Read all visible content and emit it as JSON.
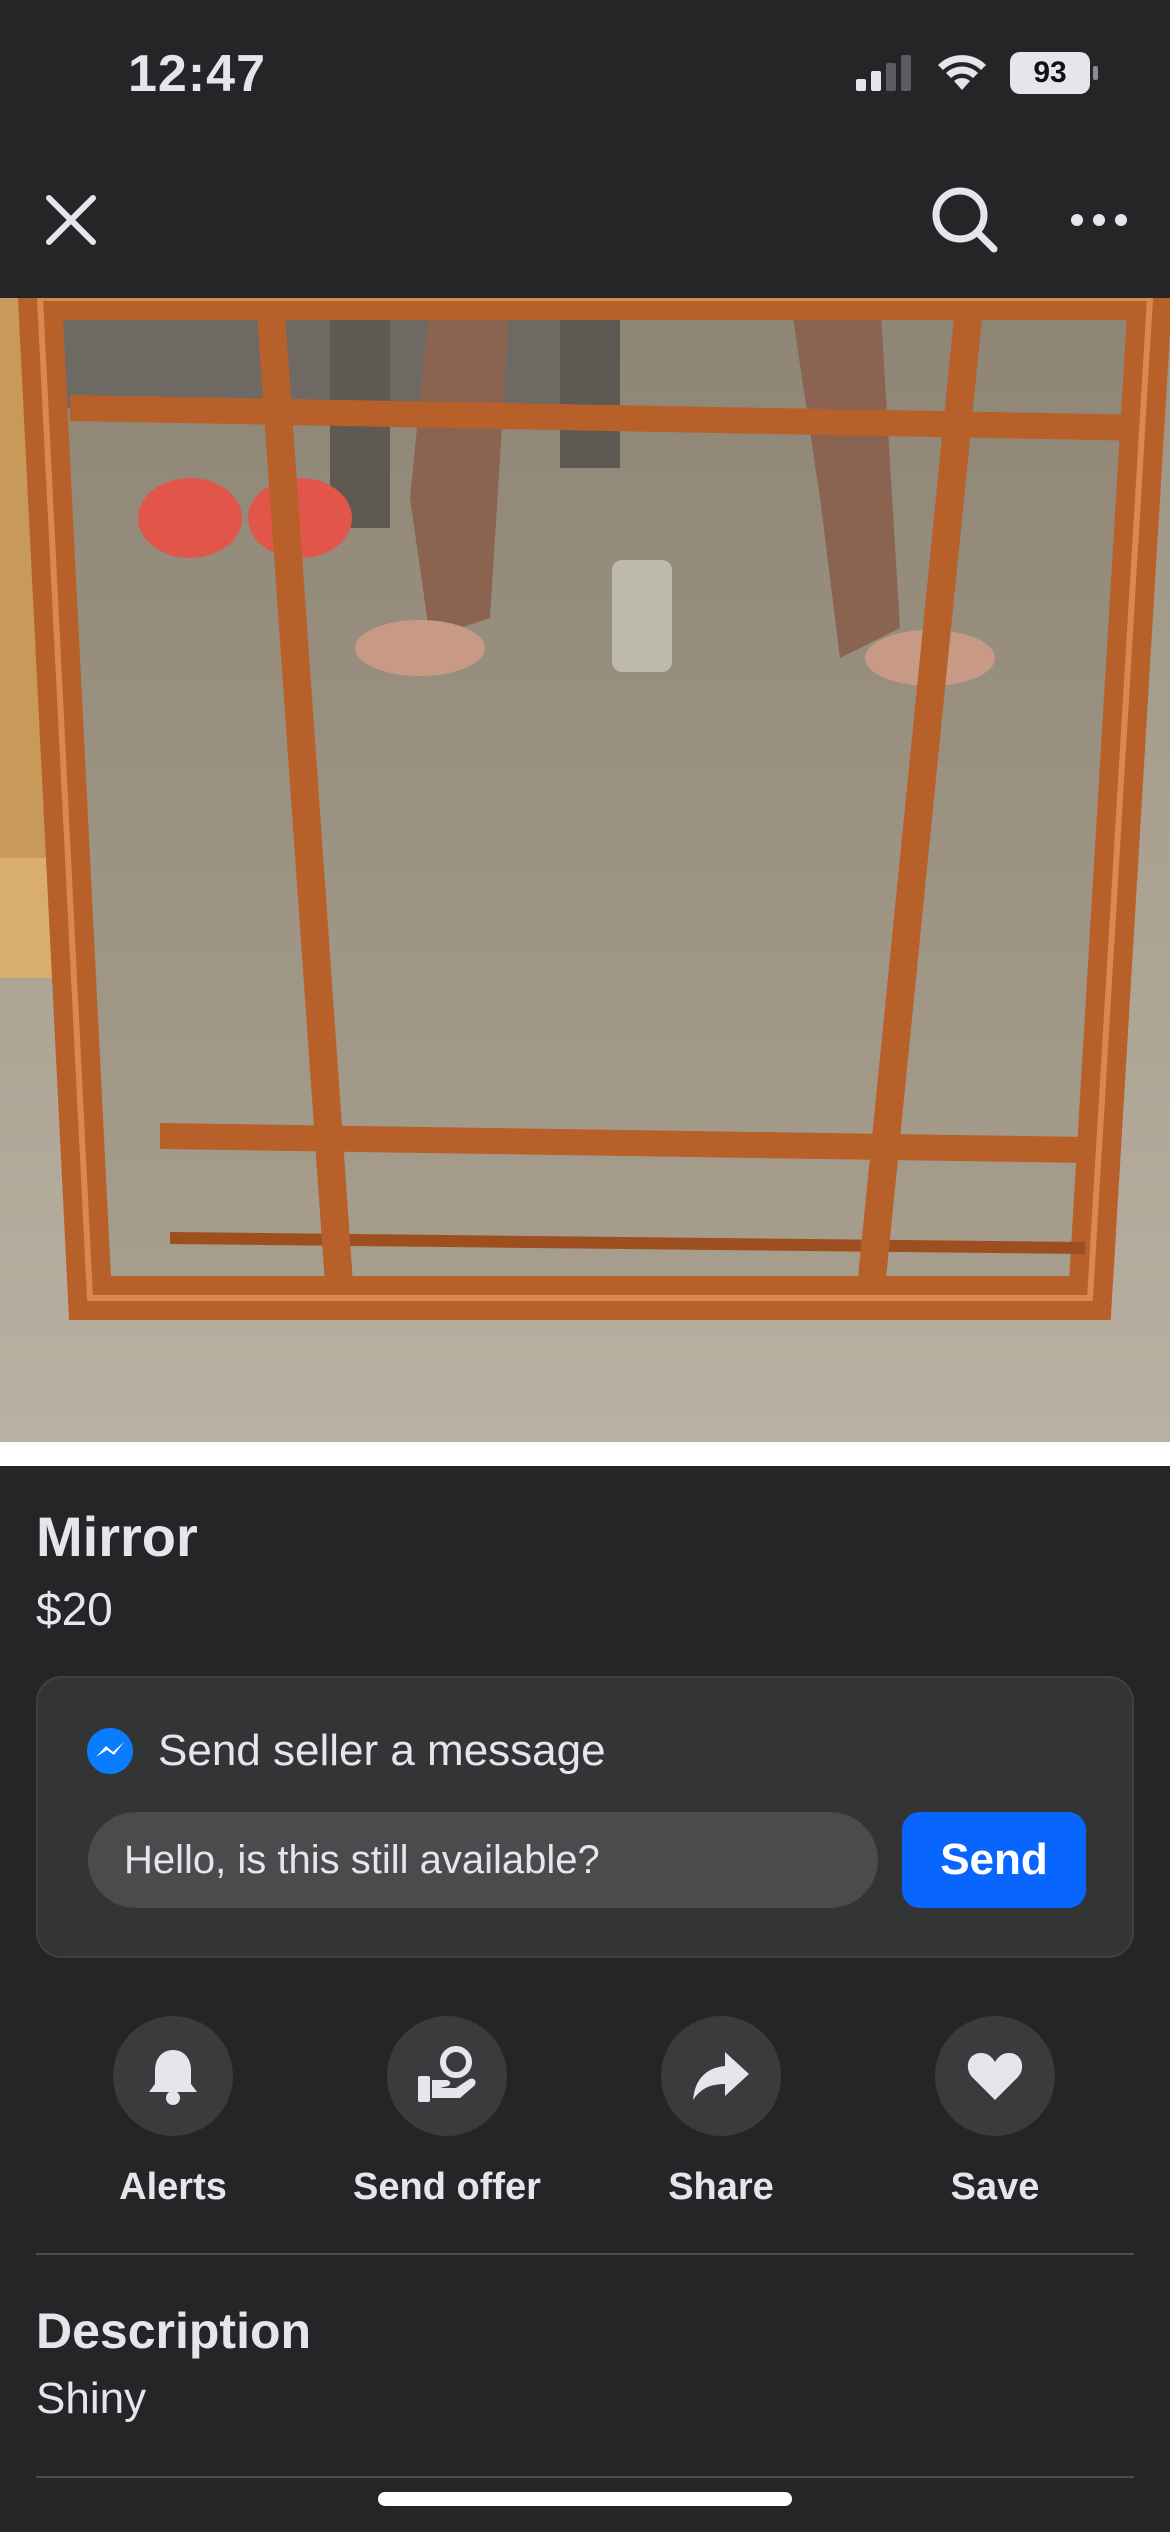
{
  "status_bar": {
    "time": "12:47",
    "battery": "93"
  },
  "nav": {
    "close_icon": "close-icon",
    "search_icon": "search-icon",
    "more_icon": "more-icon"
  },
  "listing": {
    "title": "Mirror",
    "price": "$20"
  },
  "message_card": {
    "header_label": "Send seller a message",
    "input_value": "Hello, is this still available?",
    "send_label": "Send"
  },
  "actions": [
    {
      "label": "Alerts",
      "icon": "bell-icon"
    },
    {
      "label": "Send offer",
      "icon": "send-offer-icon"
    },
    {
      "label": "Share",
      "icon": "share-icon"
    },
    {
      "label": "Save",
      "icon": "heart-icon"
    }
  ],
  "description": {
    "heading": "Description",
    "text": "Shiny"
  },
  "colors": {
    "background": "#242526",
    "accent": "#0866ff",
    "card": "#333436"
  }
}
